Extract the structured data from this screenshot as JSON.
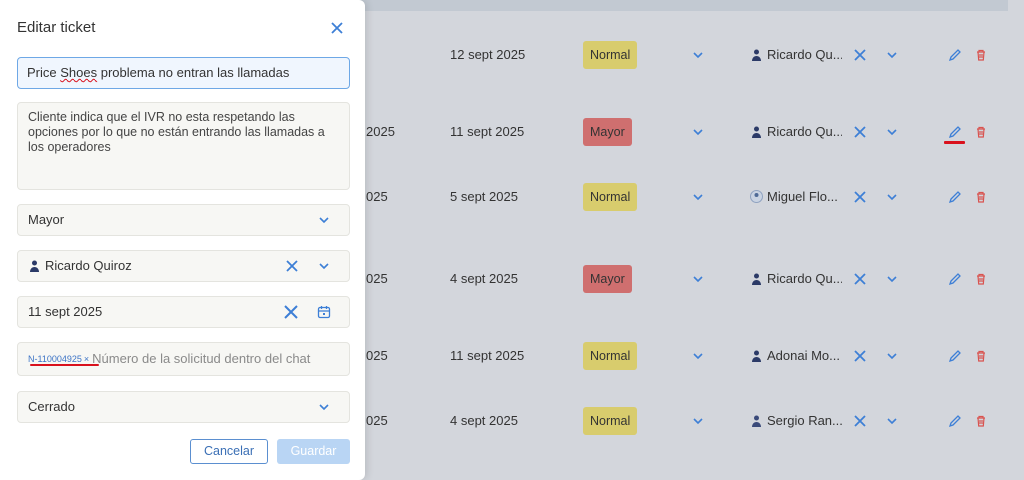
{
  "modal": {
    "title": "Editar ticket",
    "ticket_title": "Price Shoes problema no entran las llamadas",
    "ticket_title_word1": "Price",
    "ticket_title_misspelled": "Shoes",
    "ticket_title_rest": "problema no entran las llamadas",
    "description": "Cliente indica que el IVR no esta respetando las opciones por lo que no están entrando las llamadas a los operadores",
    "priority": "Mayor",
    "assignee": "Ricardo Quiroz",
    "date": "11 sept 2025",
    "chip": "N-110004925",
    "chip_x": "×",
    "request_placeholder": "Número de la solicitud dentro del chat",
    "status": "Cerrado",
    "cancel_label": "Cancelar",
    "save_label": "Guardar"
  },
  "table": {
    "rows": [
      {
        "id": "",
        "date": "12 sept 2025",
        "priority": "Normal",
        "user": "Ricardo Qu..."
      },
      {
        "id": "2025",
        "date": "11 sept 2025",
        "priority": "Mayor",
        "user": "Ricardo Qu..."
      },
      {
        "id": "025",
        "date": "5 sept 2025",
        "priority": "Normal",
        "user": "Miguel Flo..."
      },
      {
        "id": "025",
        "date": "4 sept 2025",
        "priority": "Mayor",
        "user": "Ricardo Qu..."
      },
      {
        "id": "025",
        "date": "11 sept 2025",
        "priority": "Normal",
        "user": "Adonai Mo..."
      },
      {
        "id": "025",
        "date": "4 sept 2025",
        "priority": "Normal",
        "user": "Sergio Ran..."
      }
    ]
  },
  "colors": {
    "accent": "#3d7fd6",
    "normal_badge": "#d8cc6d",
    "mayor_badge": "#cf6f6f",
    "delete": "#d9534f",
    "annotation": "#d9111d"
  }
}
